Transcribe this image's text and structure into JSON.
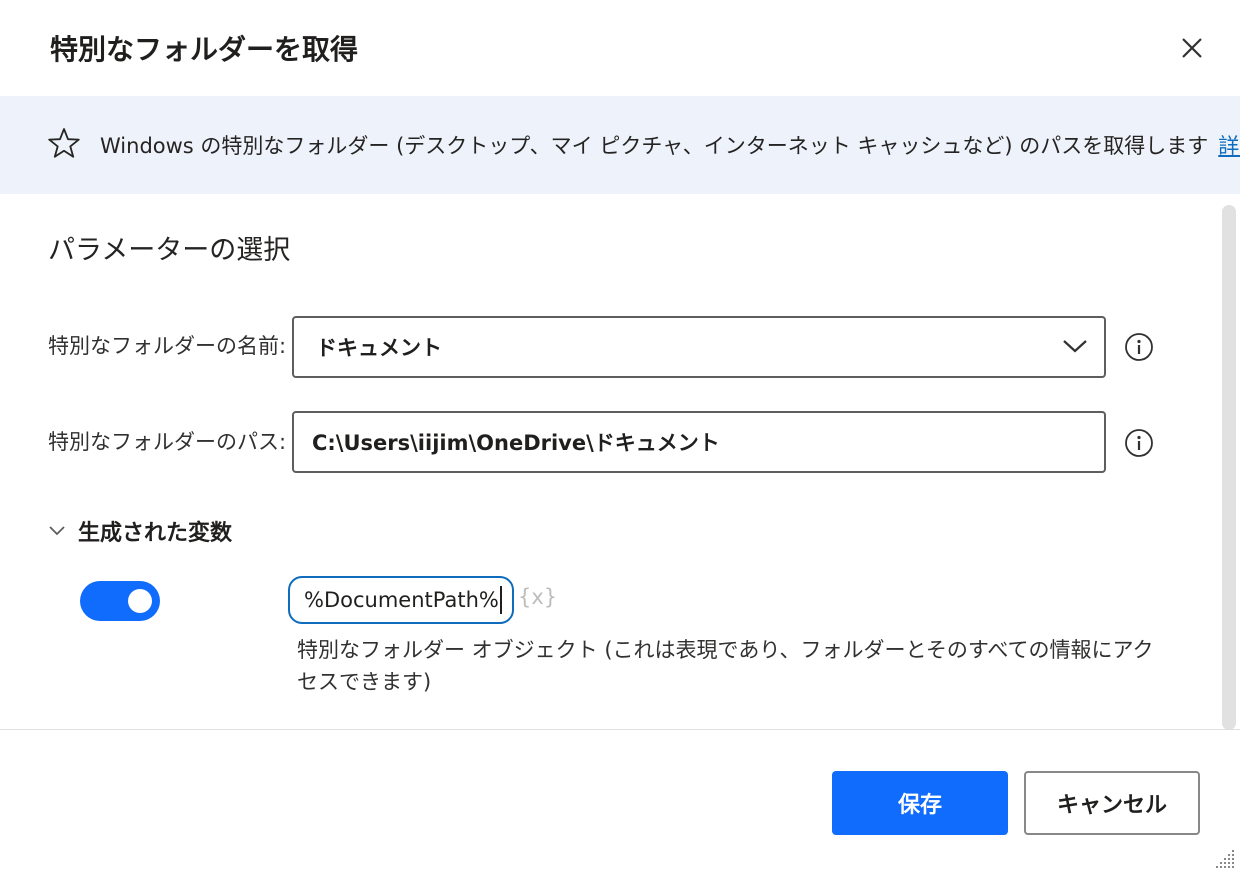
{
  "dialog": {
    "title": "特別なフォルダーを取得",
    "close_icon": "close-icon"
  },
  "banner": {
    "icon": "star-outline-icon",
    "description": "Windows の特別なフォルダー (デスクトップ、マイ ピクチャ、インターネット キャッシュなど) のパスを取得します",
    "link_label": "詳細"
  },
  "parameters": {
    "section_title": "パラメーターの選択",
    "folder_name": {
      "label": "特別なフォルダーの名前:",
      "value": "ドキュメント"
    },
    "folder_path": {
      "label": "特別なフォルダーのパス:",
      "value": "C:\\Users\\iijim\\OneDrive\\ドキュメント"
    }
  },
  "generated": {
    "header": "生成された変数",
    "toggle_on": true,
    "variable": "%DocumentPath%",
    "fx_label": "{x}",
    "description": "特別なフォルダー オブジェクト (これは表現であり、フォルダーとそのすべての情報にアクセスできます)"
  },
  "footer": {
    "save_label": "保存",
    "cancel_label": "キャンセル"
  },
  "colors": {
    "accent": "#0f6cfc",
    "banner_bg": "#eef3fb",
    "link": "#0f6cbd"
  }
}
